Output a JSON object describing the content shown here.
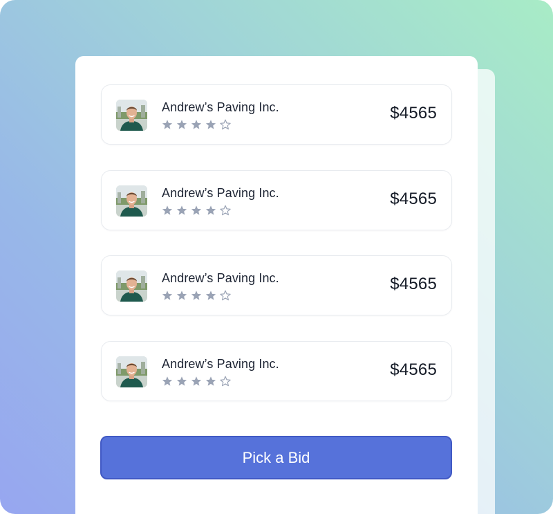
{
  "bids": [
    {
      "contractor": "Andrew’s Paving Inc.",
      "price": "$4565",
      "rating": 4,
      "max_rating": 5,
      "avatar": "contractor-photo"
    },
    {
      "contractor": "Andrew’s Paving Inc.",
      "price": "$4565",
      "rating": 4,
      "max_rating": 5,
      "avatar": "contractor-photo"
    },
    {
      "contractor": "Andrew’s Paving Inc.",
      "price": "$4565",
      "rating": 4,
      "max_rating": 5,
      "avatar": "contractor-photo"
    },
    {
      "contractor": "Andrew’s Paving Inc.",
      "price": "$4565",
      "rating": 4,
      "max_rating": 5,
      "avatar": "contractor-photo"
    }
  ],
  "action": {
    "pick_label": "Pick a Bid"
  },
  "colors": {
    "accent": "#5672da",
    "star_filled": "#9aa3b5",
    "star_empty": "#9aa3b5"
  },
  "icons": {
    "star_filled": "star-icon",
    "star_empty": "star-outline-icon"
  }
}
